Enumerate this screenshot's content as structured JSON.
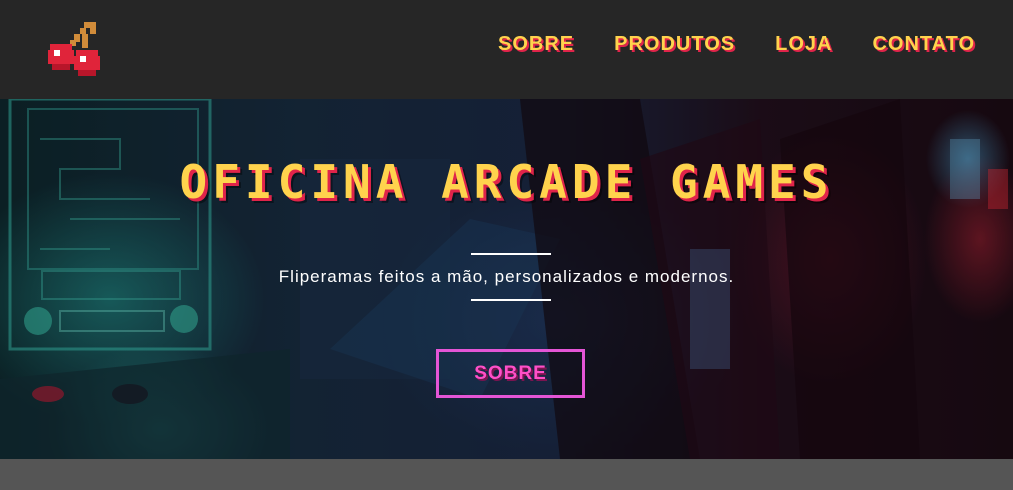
{
  "logo": {
    "icon": "cherry-icon",
    "colors": {
      "fruit": "#e0243a",
      "stem": "#d18c3a"
    }
  },
  "nav": {
    "items": [
      {
        "label": "SOBRE"
      },
      {
        "label": "PRODUTOS"
      },
      {
        "label": "LOJA"
      },
      {
        "label": "CONTATO"
      }
    ]
  },
  "hero": {
    "title": "OFICINA ARCADE GAMES",
    "tagline": "Fliperamas feitos a mão, personalizados e modernos.",
    "cta_label": "SOBRE",
    "background_icon": "arcade-machines-photo"
  },
  "colors": {
    "nav_text": "#ffd34d",
    "nav_shadow": "#e0244a",
    "cta_border": "#e455d6",
    "cta_text": "#ff4fc8",
    "topbar_bg": "#262626"
  }
}
